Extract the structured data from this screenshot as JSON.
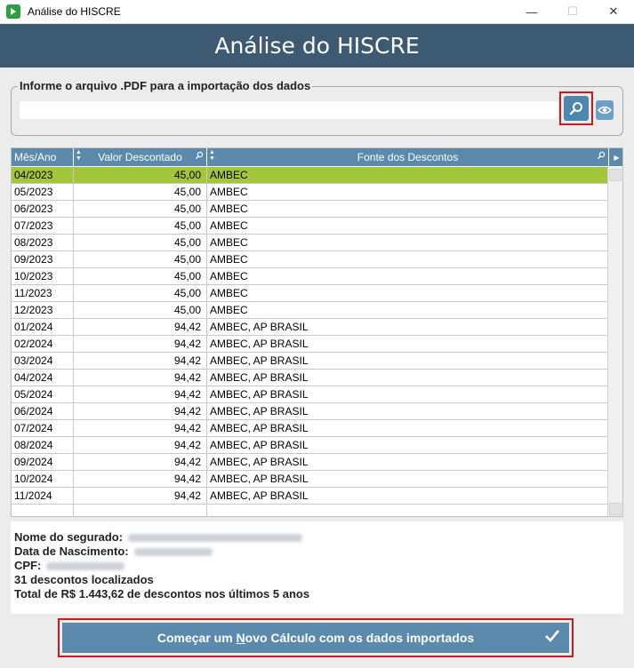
{
  "window": {
    "title": "Análise do HISCRE",
    "minimize": "—",
    "maximize": "☐",
    "close": "✕"
  },
  "header": {
    "title": "Análise do HISCRE"
  },
  "import": {
    "legend": "Informe o arquivo .PDF para a importação dos dados",
    "file_value": "",
    "search_icon": "search-icon",
    "view_icon": "eye-icon"
  },
  "grid": {
    "columns": [
      "Mês/Ano",
      "Valor Descontado",
      "Fonte dos Descontos"
    ],
    "rows": [
      [
        "04/2023",
        "45,00",
        "AMBEC"
      ],
      [
        "05/2023",
        "45,00",
        "AMBEC"
      ],
      [
        "06/2023",
        "45,00",
        "AMBEC"
      ],
      [
        "07/2023",
        "45,00",
        "AMBEC"
      ],
      [
        "08/2023",
        "45,00",
        "AMBEC"
      ],
      [
        "09/2023",
        "45,00",
        "AMBEC"
      ],
      [
        "10/2023",
        "45,00",
        "AMBEC"
      ],
      [
        "11/2023",
        "45,00",
        "AMBEC"
      ],
      [
        "12/2023",
        "45,00",
        "AMBEC"
      ],
      [
        "01/2024",
        "94,42",
        "AMBEC, AP BRASIL"
      ],
      [
        "02/2024",
        "94,42",
        "AMBEC, AP BRASIL"
      ],
      [
        "03/2024",
        "94,42",
        "AMBEC, AP BRASIL"
      ],
      [
        "04/2024",
        "94,42",
        "AMBEC, AP BRASIL"
      ],
      [
        "05/2024",
        "94,42",
        "AMBEC, AP BRASIL"
      ],
      [
        "06/2024",
        "94,42",
        "AMBEC, AP BRASIL"
      ],
      [
        "07/2024",
        "94,42",
        "AMBEC, AP BRASIL"
      ],
      [
        "08/2024",
        "94,42",
        "AMBEC, AP BRASIL"
      ],
      [
        "09/2024",
        "94,42",
        "AMBEC, AP BRASIL"
      ],
      [
        "10/2024",
        "94,42",
        "AMBEC, AP BRASIL"
      ],
      [
        "11/2024",
        "94,42",
        "AMBEC, AP BRASIL"
      ]
    ],
    "selected_row": 0
  },
  "info": {
    "nome_label": "Nome do segurado:",
    "nascimento_label": "Data de Nascimento:",
    "cpf_label": "CPF:",
    "count": "31 descontos localizados",
    "total": "Total de R$ 1.443,62 de descontos nos últimos 5 anos"
  },
  "action": {
    "label_pre": "Começar um ",
    "label_accel": "N",
    "label_post": "ovo Cálculo com os dados importados"
  },
  "colors": {
    "header_bg": "#3d5a73",
    "grid_header_bg": "#5b8aad",
    "selected_row": "#a4c63a",
    "highlight_border": "#d01818"
  }
}
